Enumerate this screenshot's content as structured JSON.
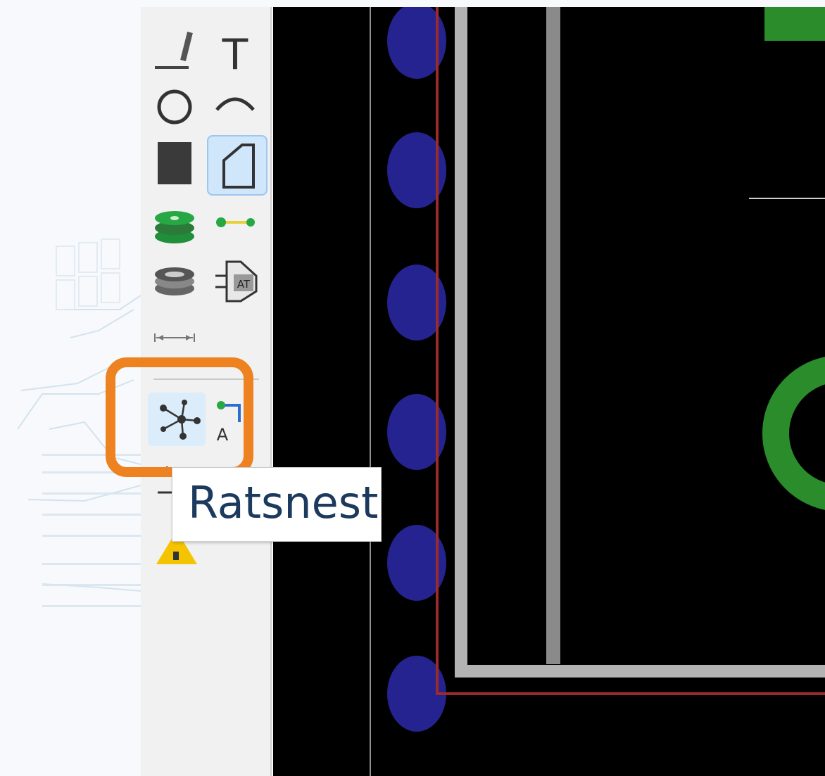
{
  "toolbar": {
    "tools": [
      {
        "name": "draw-line-tool",
        "icon": "line-pencil-icon"
      },
      {
        "name": "add-text-tool",
        "icon": "text-icon"
      },
      {
        "name": "draw-circle-tool",
        "icon": "circle-icon"
      },
      {
        "name": "draw-arc-tool",
        "icon": "arc-icon"
      },
      {
        "name": "draw-rectangle-tool",
        "icon": "filled-rectangle-icon"
      },
      {
        "name": "draw-polygon-tool",
        "icon": "polygon-icon",
        "active": true
      },
      {
        "name": "add-via-tool",
        "icon": "via-stack-icon"
      },
      {
        "name": "route-track-tool",
        "icon": "track-icon"
      },
      {
        "name": "add-layer-tool",
        "icon": "layer-stack-icon"
      },
      {
        "name": "add-footprint-tool",
        "icon": "footprint-chip-icon"
      },
      {
        "name": "dimension-tool",
        "icon": "dimension-icon"
      },
      {
        "name": "ratsnest-tool",
        "icon": "ratsnest-icon",
        "active": true
      },
      {
        "name": "auto-route-tool",
        "icon": "autoroute-icon"
      },
      {
        "name": "drc-warning-tool",
        "icon": "warning-icon"
      }
    ],
    "text_icon_glyph": "T",
    "autoroute_glyph": "A",
    "footprint_glyph": "AT"
  },
  "tooltip": {
    "text": "Ratsnest"
  },
  "colors": {
    "accent_highlight": "#ef8220",
    "canvas_background": "#000000",
    "pad_blue": "#25238f",
    "board_outline": "#9b2a2a",
    "courtyard_gray": "#b3b3b3",
    "silkscreen_green": "#2a8c2a",
    "active_tool_background": "#cfe6fb"
  }
}
